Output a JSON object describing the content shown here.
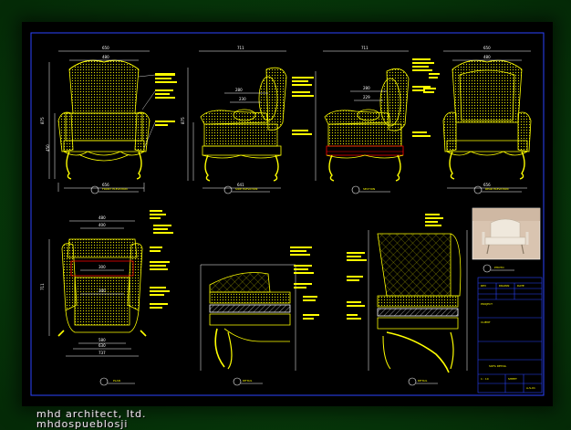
{
  "viewer": {
    "background_color": "#0b4410",
    "sheet_color": "#000000"
  },
  "watermark": {
    "line1": "mhd architect, ltd.",
    "line2": "mhdospueblosji"
  },
  "drawing": {
    "dimensions": {
      "front_width": "650",
      "front_inner": "480",
      "front_height": "875",
      "front_seat": "450",
      "front_base": "656",
      "side_width": "711",
      "side_arm": "280",
      "side_back": "230",
      "side_height": "875",
      "side_base": "641",
      "section_width": "711",
      "section_h1": "280",
      "section_h2": "229",
      "rear_width": "650",
      "rear_inner": "480",
      "rear_base": "656",
      "plan_top": "480",
      "plan_inner": "400",
      "plan_mid": "300",
      "plan_mid2": "300",
      "plan_depth": "711",
      "plan_b1": "580",
      "plan_b2": "630",
      "plan_b3": "737"
    },
    "titles": {
      "front": "FRONT ELEVATION",
      "side": "SIDE ELEVATION",
      "section": "SECTION",
      "rear": "REAR ELEVATION",
      "plan": "PLAN",
      "detail1": "DETAIL",
      "detail2": "DETAIL",
      "photo_caption": "PHOTO"
    },
    "title_block": {
      "project": "PROJECT",
      "drawing_title": "SOFA DETAIL",
      "client": "CLIENT",
      "scale": "1 : 10",
      "sheet": "SHEET",
      "rev": "REV",
      "drawn": "DRAWN",
      "date": "DATE",
      "number": "A-S-01"
    },
    "colors": {
      "outline": "#ffff00",
      "dimension": "#ffffff",
      "text": "#ffff00",
      "leader": "#ffffff",
      "accent": "#ff0000",
      "hatch": "#e5e500",
      "frame": "#2b44ff",
      "photo_bg": "#d9c4b0",
      "photo_chair": "#efe8dc"
    }
  }
}
